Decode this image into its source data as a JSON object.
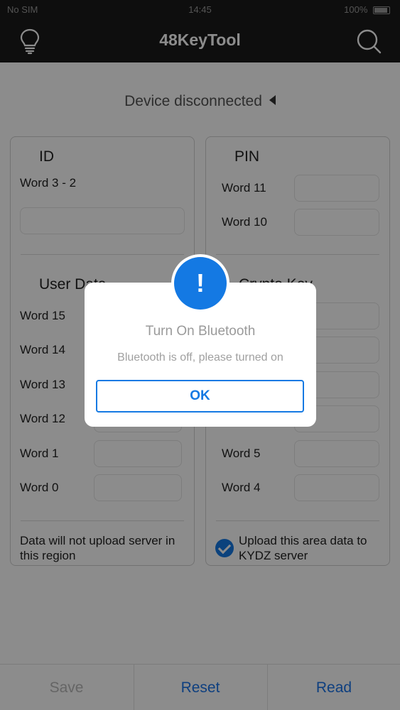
{
  "status_bar": {
    "carrier": "No SIM",
    "time": "14:45",
    "battery": "100%"
  },
  "nav": {
    "title": "48KeyTool",
    "left_icon": "lightbulb-icon",
    "right_icon": "search-icon"
  },
  "device_status": "Device disconnected",
  "left_panel": {
    "id_title": "ID",
    "id_label": "Word 3 - 2",
    "user_data_title": "User Data",
    "rows": [
      "Word 15",
      "Word 14",
      "Word 13",
      "Word 12",
      "Word 1",
      "Word 0"
    ],
    "note": "Data will not upload server in this region"
  },
  "right_panel": {
    "pin_title": "PIN",
    "pin_rows": [
      "Word 11",
      "Word 10"
    ],
    "crypto_title": "Crypto Key",
    "crypto_rows": [
      "Word 5",
      "Word 4"
    ],
    "upload_label": "Upload this area data to KYDZ server",
    "upload_checked": true
  },
  "bottom": {
    "save": "Save",
    "reset": "Reset",
    "read": "Read"
  },
  "dialog": {
    "title": "Turn On Bluetooth",
    "message": "Bluetooth is off, please turned on",
    "ok": "OK",
    "badge": "!"
  },
  "colors": {
    "accent": "#1479e3",
    "nav_bg": "#1a1a1a",
    "disabled": "#b8b8b8"
  }
}
